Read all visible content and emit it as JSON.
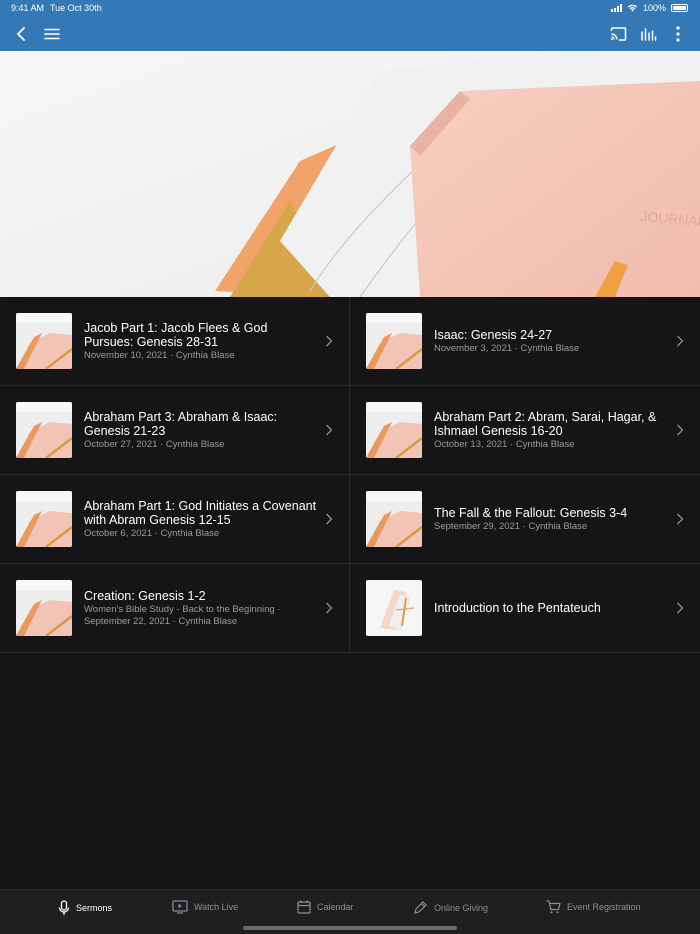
{
  "status": {
    "time": "9:41 AM",
    "date": "Tue Oct 30th",
    "battery": "100%"
  },
  "navbar": {
    "back_icon": "chevron-left-icon",
    "menu_icon": "hamburger-icon",
    "cast_icon": "cast-icon",
    "audio_icon": "audio-bars-icon",
    "more_icon": "more-vertical-icon"
  },
  "sermons": [
    {
      "title": "Jacob Part 1: Jacob Flees & God Pursues: Genesis 28-31",
      "meta": "November 10, 2021 · Cynthia Blase"
    },
    {
      "title": "Isaac: Genesis 24-27",
      "meta": "November 3, 2021 · Cynthia Blase"
    },
    {
      "title": "Abraham Part 3: Abraham & Isaac: Genesis 21-23",
      "meta": "October 27, 2021 · Cynthia Blase"
    },
    {
      "title": "Abraham Part 2: Abram, Sarai, Hagar, & Ishmael Genesis 16-20",
      "meta": "October 13, 2021 · Cynthia Blase"
    },
    {
      "title": "Abraham Part 1: God Initiates a Covenant with Abram Genesis 12-15",
      "meta": "October 6, 2021 · Cynthia Blase"
    },
    {
      "title": "The Fall & the Fallout: Genesis 3-4",
      "meta": "September 29, 2021 · Cynthia Blase"
    },
    {
      "title": "Creation: Genesis 1-2",
      "meta": "Women's Bible Study - Back to the Beginning · September 22, 2021 · Cynthia Blase"
    },
    {
      "title": "Introduction to the Pentateuch",
      "meta": ""
    }
  ],
  "tabs": [
    {
      "label": "Sermons",
      "icon": "microphone-icon",
      "active": true
    },
    {
      "label": "Watch Live",
      "icon": "play-screen-icon",
      "active": false
    },
    {
      "label": "Calendar",
      "icon": "calendar-icon",
      "active": false
    },
    {
      "label": "Online Giving",
      "icon": "pen-icon",
      "active": false
    },
    {
      "label": "Event Registration",
      "icon": "cart-icon",
      "active": false
    }
  ],
  "colors": {
    "accent": "#3478b6",
    "background": "#151517",
    "tabbar": "#1f1f21"
  }
}
